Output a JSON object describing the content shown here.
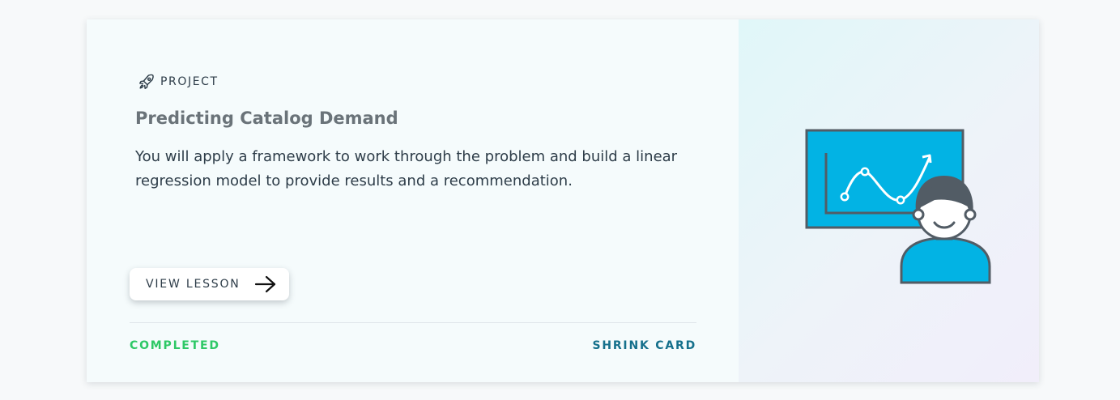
{
  "card": {
    "type_label": "PROJECT",
    "type_icon": "rocket-icon",
    "title": "Predicting Catalog Demand",
    "description": "You will apply a framework to work through the problem and build a linear regression model to provide results and a recommendation.",
    "cta_label": "VIEW LESSON",
    "cta_icon": "arrow-right-icon",
    "status": "COMPLETED",
    "status_color": "#2ec866",
    "toggle_label": "SHRINK CARD",
    "illustration": "presenter-with-chart-illustration"
  },
  "colors": {
    "accent": "#02b3e4",
    "link": "#15708c",
    "text": "#2e3d49",
    "title": "#6a7379"
  }
}
